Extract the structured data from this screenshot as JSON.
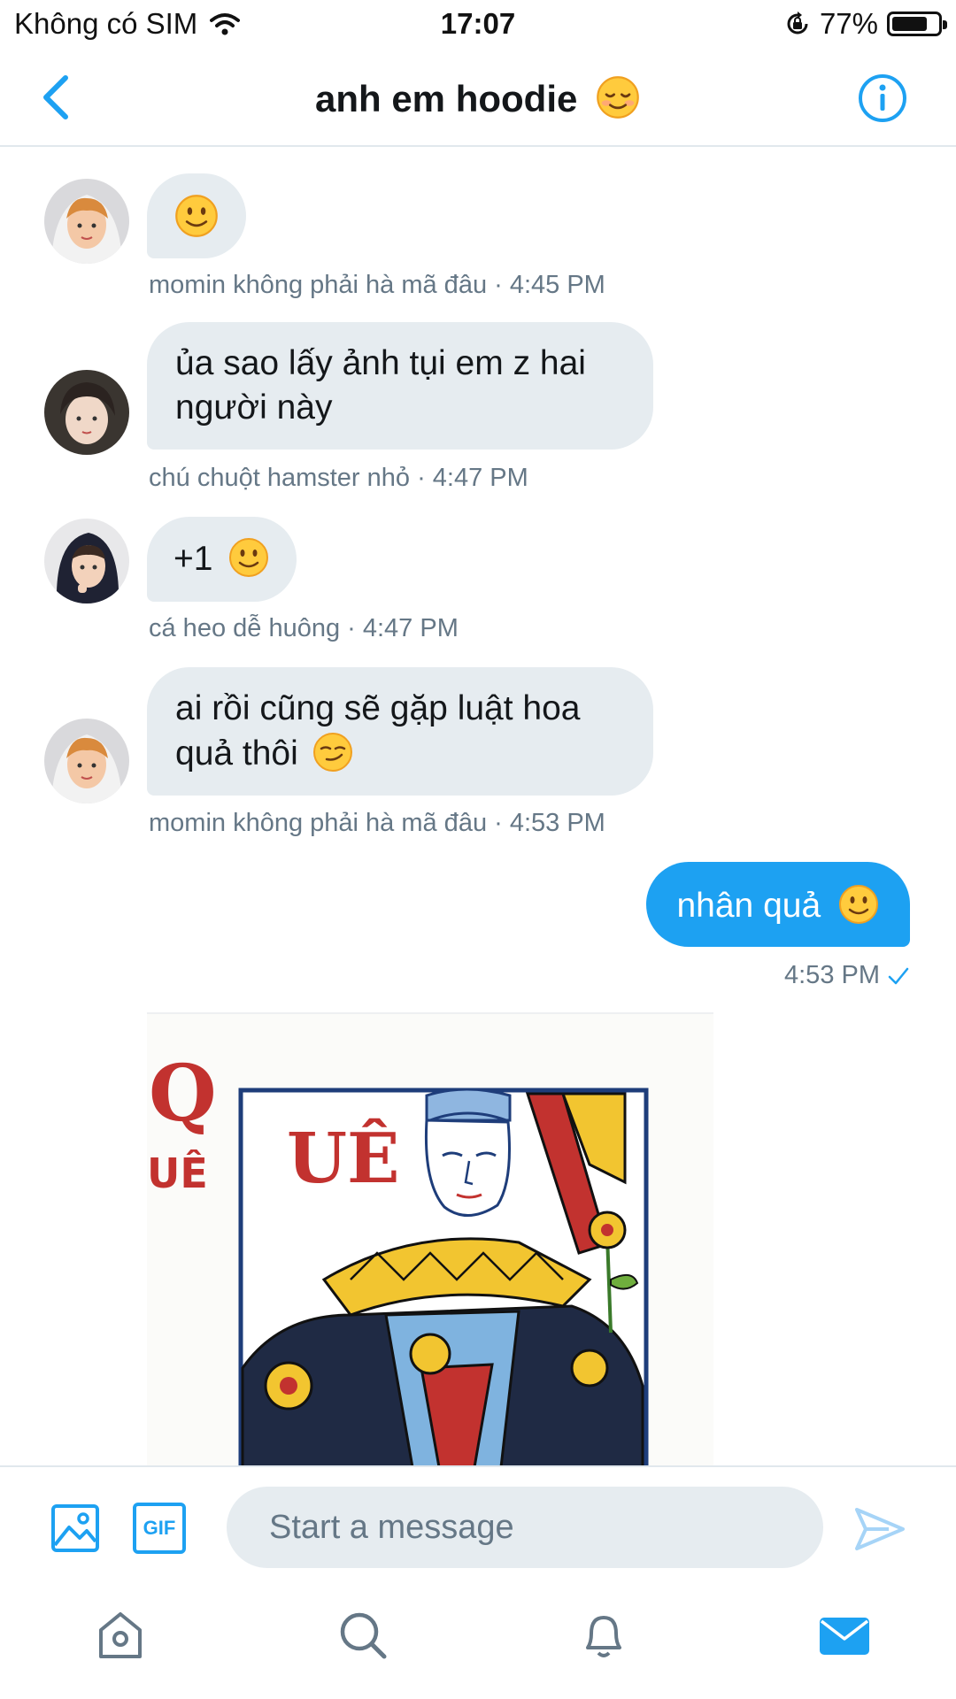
{
  "status_bar": {
    "carrier": "Không có SIM",
    "time": "17:07",
    "battery": "77%",
    "battery_level": 0.77
  },
  "header": {
    "title": "anh em hoodie"
  },
  "messages": [
    {
      "text": "",
      "sender": "momin không phải hà mã đâu",
      "time": "4:45 PM",
      "meta": "momin không phải hà mã đâu · 4:45 PM"
    },
    {
      "text": "ủa sao lấy ảnh tụi em z hai người này",
      "sender": "chú chuột hamster nhỏ",
      "time": "4:47 PM",
      "meta": "chú chuột hamster nhỏ · 4:47 PM"
    },
    {
      "text": "+1",
      "sender": "cá heo dễ huông",
      "time": "4:47 PM",
      "meta": "cá heo dễ huông · 4:47 PM"
    },
    {
      "text": "ai rồi cũng sẽ gặp luật hoa quả thôi",
      "sender": "momin không phải hà mã đâu",
      "time": "4:53 PM",
      "meta": "momin không phải hà mã đâu · 4:53 PM"
    }
  ],
  "outgoing": {
    "text": "nhân quả",
    "time": "4:53 PM"
  },
  "image_card": {
    "rank": "Q",
    "small_label": "UÊ",
    "big_label": "UÊ"
  },
  "composer": {
    "placeholder": "Start a message",
    "gif_label": "GIF"
  },
  "colors": {
    "accent": "#1da1f2",
    "bubble_in": "#e6ecf0",
    "meta_text": "#657786"
  }
}
